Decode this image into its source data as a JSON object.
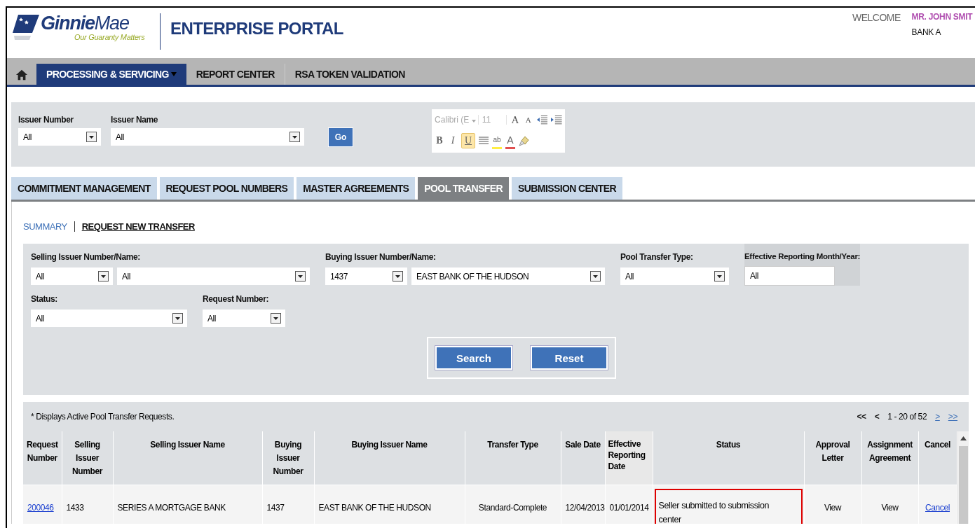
{
  "header": {
    "logo_name": "**Ginnie**Mae",
    "tagline": "Our Guaranty Matters",
    "title": "ENTERPRISE PORTAL",
    "welcome": "WELCOME",
    "user": "MR. JOHN SMIT",
    "bank": "BANK A"
  },
  "nav": [
    {
      "label": "PROCESSING & SERVICING",
      "selected": true,
      "dropdown": true
    },
    {
      "label": "REPORT CENTER",
      "selected": false,
      "dropdown": false
    },
    {
      "label": "RSA TOKEN VALIDATION",
      "selected": false,
      "dropdown": false
    }
  ],
  "issuer_filter": {
    "fields": [
      {
        "label": "Issuer Number",
        "value": "All"
      },
      {
        "label": "Issuer Name",
        "value": "All"
      }
    ],
    "go": "Go"
  },
  "editor_toolbar": {
    "font": "Calibri (E",
    "size": "11",
    "row_1": [
      {
        "kind": "grow",
        "label": "A",
        "selected": false
      },
      {
        "kind": "shrink",
        "label": "A",
        "selected": false
      },
      {
        "kind": "outdent",
        "selected": false
      },
      {
        "kind": "indent",
        "selected": false
      }
    ],
    "row_2": [
      {
        "kind": "bold",
        "label": "B",
        "selected": false
      },
      {
        "kind": "italic",
        "label": "I",
        "selected": false
      },
      {
        "kind": "underline",
        "label": "U",
        "selected": true
      },
      {
        "kind": "align",
        "selected": false
      },
      {
        "kind": "highlight",
        "label": "ab",
        "selected": false
      },
      {
        "kind": "font_color",
        "label": "A",
        "selected": false
      },
      {
        "kind": "clear",
        "selected": false
      }
    ]
  },
  "tabs": [
    {
      "label": "COMMITMENT MANAGEMENT",
      "selected": false
    },
    {
      "label": "REQUEST POOL NUMBERS",
      "selected": false
    },
    {
      "label": "MASTER AGREEMENTS",
      "selected": false
    },
    {
      "label": "POOL TRANSFER",
      "selected": true
    },
    {
      "label": "SUBMISSION CENTER",
      "selected": false
    }
  ],
  "subnav": [
    {
      "label": "SUMMARY",
      "selected": true
    },
    {
      "label": "REQUEST NEW TRANSFER",
      "selected": false
    }
  ],
  "filters": [
    [
      {
        "label": "Selling Issuer Number/Name:",
        "kind": "select_pair",
        "values": [
          "All",
          "All"
        ]
      },
      {
        "label": "Buying Issuer Number/Name:",
        "kind": "select_pair",
        "values": [
          "1437",
          "EAST BANK OF THE HUDSON"
        ]
      },
      {
        "label": "Pool Transfer Type:",
        "kind": "select",
        "values": [
          "All"
        ]
      },
      {
        "label": "Effective Reporting Month/Year:",
        "kind": "text",
        "values": [
          "All"
        ]
      }
    ],
    [
      {
        "label": "Status:",
        "kind": "select",
        "values": [
          "All"
        ]
      },
      {
        "label": "Request Number:",
        "kind": "select",
        "values": [
          "All"
        ]
      }
    ]
  ],
  "buttons": [
    "Search",
    "Reset"
  ],
  "note": "* Displays Active Pool Transfer Requests.",
  "pager": {
    "first": "<<",
    "prev": "<",
    "range": "1 - 20 of 52",
    "next": ">",
    "last": ">>"
  },
  "table": {
    "columns": [
      "Request Number",
      "Selling Issuer Number",
      "Selling Issuer Name",
      "Buying Issuer Number",
      "Buying Issuer Name",
      "Transfer Type",
      "Sale Date",
      "Effective Reporting Date",
      "Status",
      "Approval Letter",
      "Assignment Agreement",
      "Cancel"
    ],
    "rows": [
      {
        "cells": [
          {
            "text": "200046",
            "kind": "link",
            "highlighted": false
          },
          {
            "text": "1433",
            "kind": "text",
            "highlighted": false
          },
          {
            "text": "SERIES A MORTGAGE BANK",
            "kind": "text",
            "highlighted": false
          },
          {
            "text": "1437",
            "kind": "text",
            "highlighted": false
          },
          {
            "text": "EAST BANK OF THE HUDSON",
            "kind": "text",
            "highlighted": false
          },
          {
            "text": "Standard-Complete",
            "kind": "center",
            "highlighted": false
          },
          {
            "text": "12/04/2013",
            "kind": "center",
            "highlighted": false
          },
          {
            "text": "01/01/2014",
            "kind": "center",
            "highlighted": false
          },
          {
            "text": "Seller submitted to submission center",
            "kind": "text",
            "highlighted": true
          },
          {
            "text": "View",
            "kind": "center",
            "highlighted": false
          },
          {
            "text": "View",
            "kind": "center",
            "highlighted": false
          },
          {
            "text": "Cancel",
            "kind": "link",
            "highlighted": false
          }
        ]
      }
    ]
  }
}
